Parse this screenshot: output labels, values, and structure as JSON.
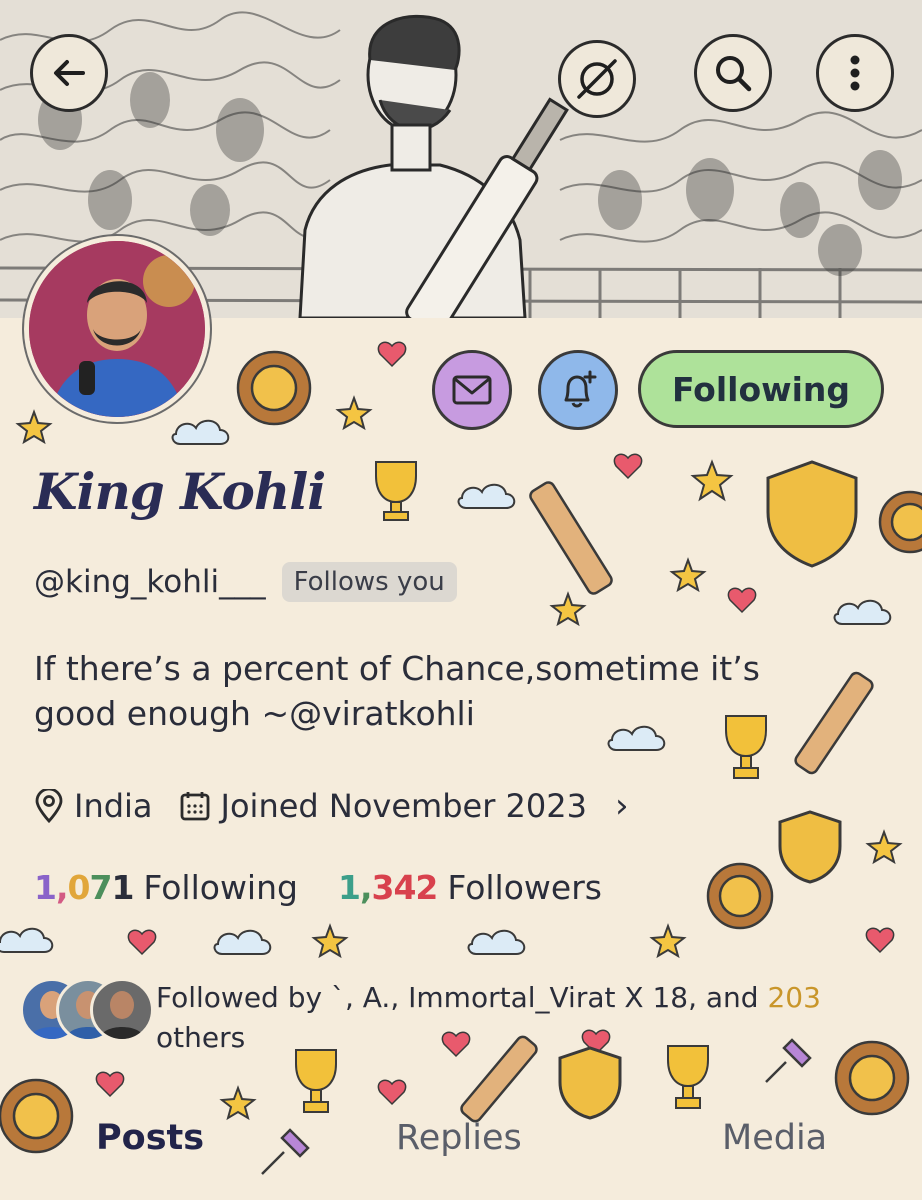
{
  "profile": {
    "display_name": "King Kohli",
    "handle": "@king_kohli___",
    "follows_you": "Follows you",
    "bio": "If there’s a percent of Chance,sometime it’s good enough ~@viratkohli",
    "location": "India",
    "joined": "Joined November 2023",
    "following_count": "1,071",
    "following_label": "Following",
    "followers_count": "1,342",
    "followers_label": "Followers",
    "followed_by_prefix": "Followed by `, A., Immortal_Virat X 18, and ",
    "followed_by_count": "203",
    "followed_by_suffix": "others"
  },
  "actions": {
    "following_button": "Following"
  },
  "tabs": [
    {
      "label": "Posts",
      "active": true
    },
    {
      "label": "Replies",
      "active": false
    },
    {
      "label": "Media",
      "active": false
    }
  ],
  "icons": {
    "back": "arrow-left-icon",
    "grok": "slash-circle-icon",
    "search": "search-icon",
    "more": "more-vertical-icon",
    "message": "envelope-icon",
    "notify": "bell-plus-icon",
    "location": "location-pin-icon",
    "calendar": "calendar-icon",
    "chevron": "chevron-right-icon"
  },
  "colors": {
    "background": "#f5ecdc",
    "following_button": "#aee29a",
    "message_button": "#c79be0",
    "bell_button": "#8fb8ea",
    "name": "#2a2c55",
    "followed_count": "#c9962a"
  }
}
